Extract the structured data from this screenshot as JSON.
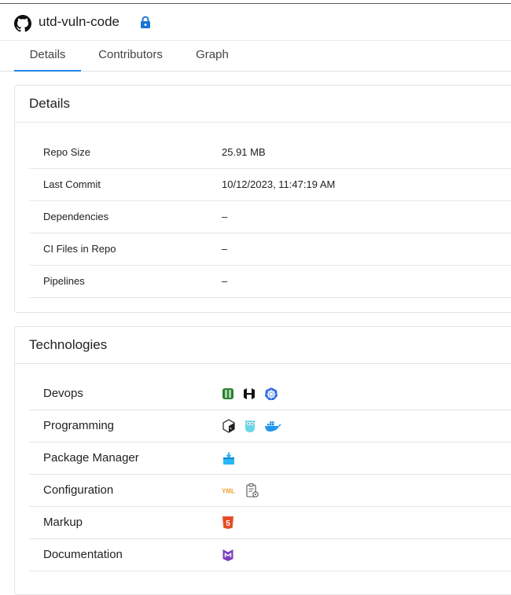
{
  "header": {
    "repo_name": "utd-vuln-code",
    "private": true
  },
  "tabs": [
    {
      "label": "Details",
      "active": true
    },
    {
      "label": "Contributors",
      "active": false
    },
    {
      "label": "Graph",
      "active": false
    }
  ],
  "details": {
    "title": "Details",
    "rows": [
      {
        "label": "Repo Size",
        "value": "25.91 MB"
      },
      {
        "label": "Last Commit",
        "value": "10/12/2023, 11:47:19 AM"
      },
      {
        "label": "Dependencies",
        "value": "–"
      },
      {
        "label": "CI Files in Repo",
        "value": "–"
      },
      {
        "label": "Pipelines",
        "value": "–"
      }
    ]
  },
  "technologies": {
    "title": "Technologies",
    "rows": [
      {
        "label": "Devops",
        "icons": [
          "vagrant-icon",
          "hashicorp-icon",
          "kubernetes-icon"
        ]
      },
      {
        "label": "Programming",
        "icons": [
          "shell-icon",
          "gopher-icon",
          "docker-icon"
        ]
      },
      {
        "label": "Package Manager",
        "icons": [
          "package-box-icon"
        ]
      },
      {
        "label": "Configuration",
        "icons": [
          "yaml-icon",
          "config-file-icon"
        ]
      },
      {
        "label": "Markup",
        "icons": [
          "html5-icon"
        ]
      },
      {
        "label": "Documentation",
        "icons": [
          "markdown-icon"
        ]
      }
    ]
  },
  "colors": {
    "accent": "#1e88e5",
    "lock": "#1976d2",
    "html5": "#e44d26",
    "kubernetes": "#326ce5",
    "docker": "#2496ed",
    "markdown": "#7b3fbf",
    "yaml": "#f0a030",
    "vagrant": "#2e7d32"
  },
  "yaml_text": "YML",
  "html5_text": "5"
}
